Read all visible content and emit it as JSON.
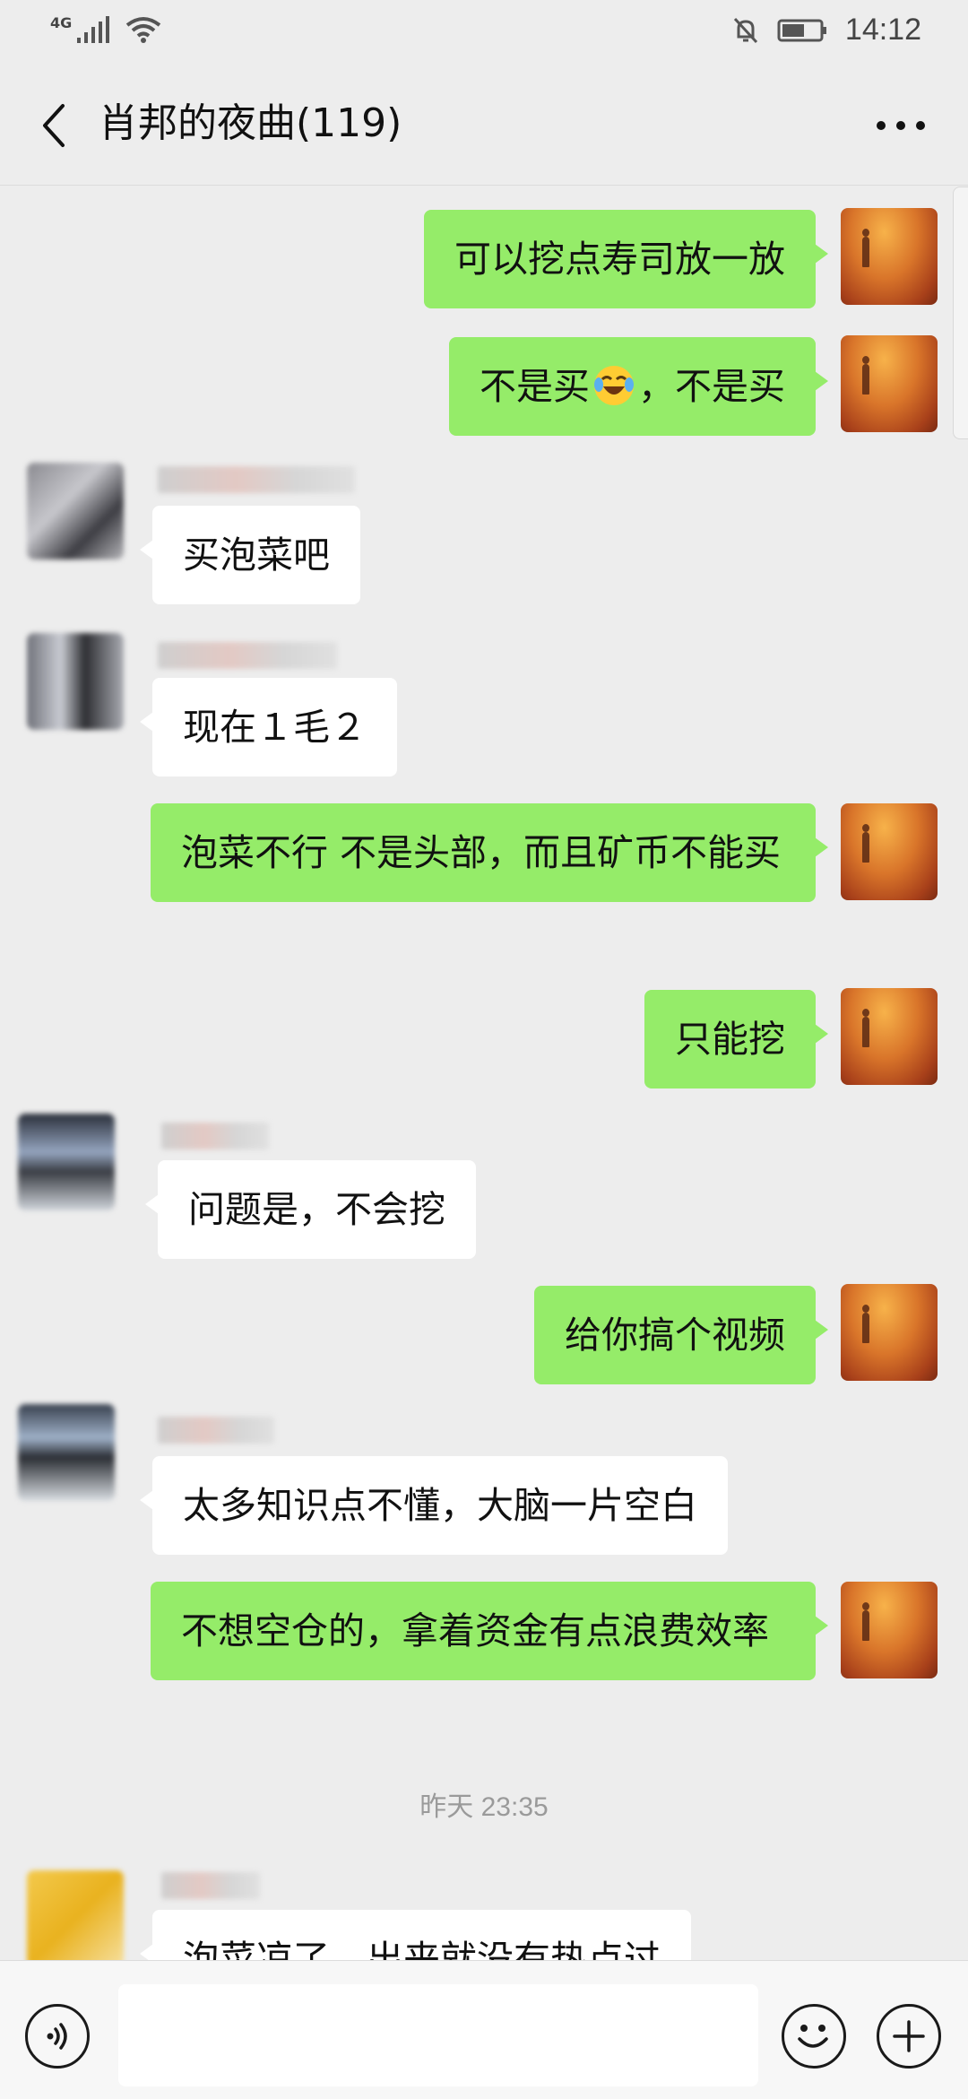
{
  "status_bar": {
    "network": "4G",
    "time": "14:12",
    "icons": [
      "signal-icon",
      "wifi-icon",
      "mute-bell-icon",
      "battery-icon"
    ]
  },
  "header": {
    "title": "肖邦的夜曲(119)",
    "back_icon": "chevron-left-icon",
    "more_icon": "more-dots-icon"
  },
  "messages": [
    {
      "side": "out",
      "text": "可以挖点寿司放一放"
    },
    {
      "side": "out",
      "text_before": "不是买",
      "emoji": "laughing-crying-emoji",
      "text_after": "，不是买"
    },
    {
      "side": "in",
      "text": "买泡菜吧"
    },
    {
      "side": "in",
      "text": "现在１毛２"
    },
    {
      "side": "out",
      "text": "泡菜不行  不是头部，而且矿币不能买"
    },
    {
      "side": "out",
      "text": "只能挖"
    },
    {
      "side": "in",
      "text": "问题是，不会挖"
    },
    {
      "side": "out",
      "text": "给你搞个视频"
    },
    {
      "side": "in",
      "text": "太多知识点不懂，大脑一片空白"
    },
    {
      "side": "out",
      "text": "不想空仓的，拿着资金有点浪费效率"
    },
    {
      "side": "in",
      "text": "泡菜凉了，出来就没有热点过"
    }
  ],
  "timestamp": "昨天 23:35",
  "input_bar": {
    "voice_icon": "voice-icon",
    "input_value": "",
    "emoji_icon": "emoji-icon",
    "plus_icon": "plus-icon"
  },
  "colors": {
    "background": "#ededed",
    "outgoing_bubble": "#95ec69",
    "incoming_bubble": "#ffffff"
  }
}
